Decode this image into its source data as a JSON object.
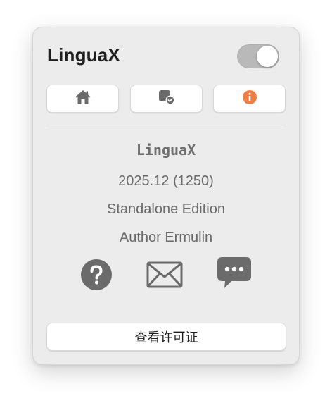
{
  "app": {
    "title": "LinguaX",
    "enabled": true
  },
  "tabs": [
    {
      "icon": "home-icon",
      "active": false
    },
    {
      "icon": "app-settings-icon",
      "active": false
    },
    {
      "icon": "info-icon",
      "active": true
    }
  ],
  "about": {
    "name": "LinguaX",
    "version": "2025.12 (1250)",
    "edition": "Standalone Edition",
    "author": "Author Ermulin"
  },
  "contact": [
    {
      "icon": "help-icon"
    },
    {
      "icon": "mail-icon"
    },
    {
      "icon": "chat-icon"
    }
  ],
  "license_button": {
    "label": "查看许可证"
  },
  "colors": {
    "accent": "#f07c42",
    "icon_gray": "#6b6b6b",
    "panel_bg": "#ececec",
    "toggle_bg": "#b9b9b9"
  }
}
